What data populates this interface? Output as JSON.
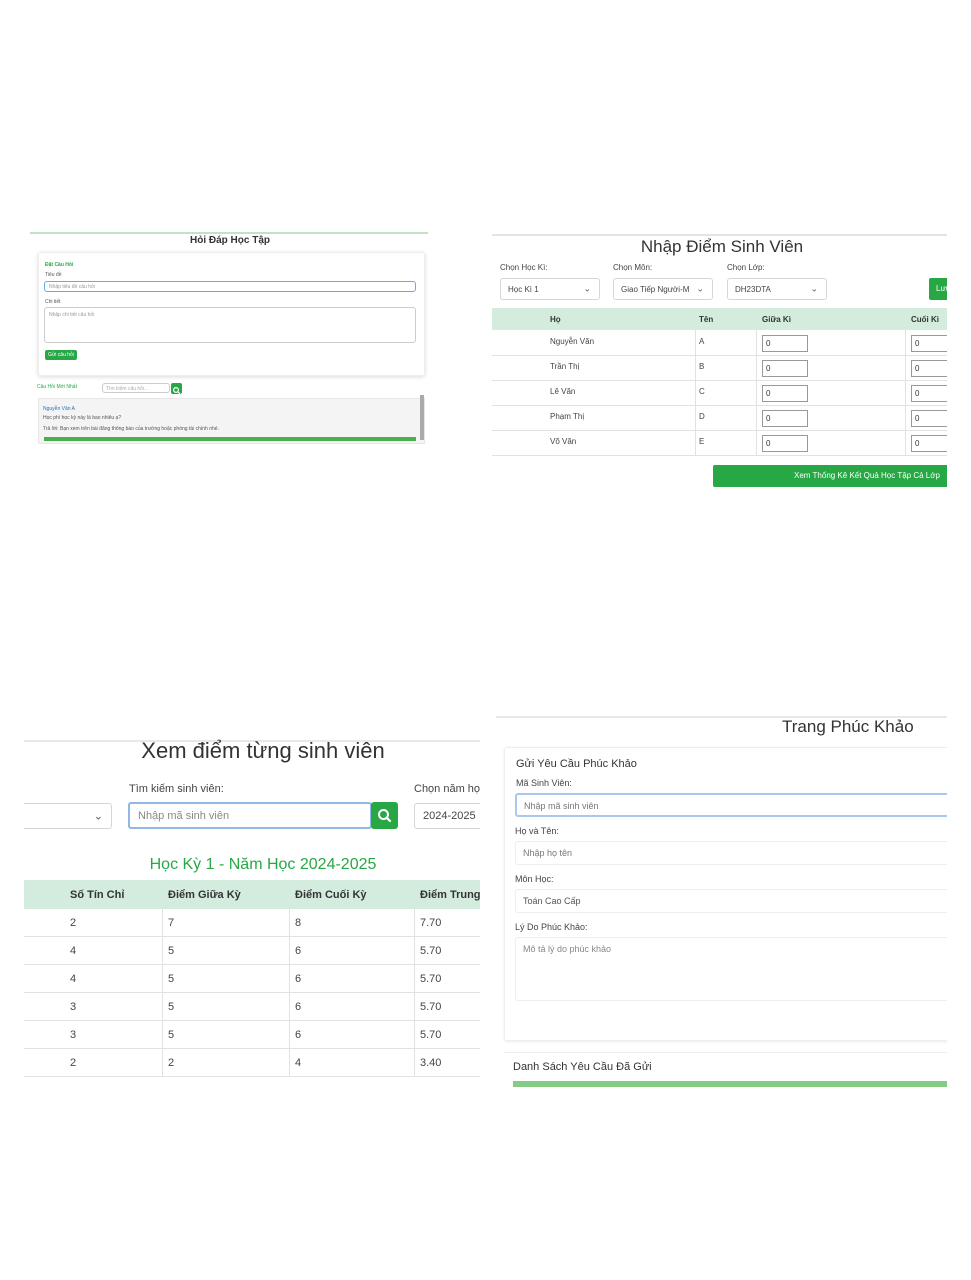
{
  "qa": {
    "title": "Hỏi Đáp Học Tập",
    "form_heading": "Đặt Câu Hỏi",
    "title_label": "Tiêu đề",
    "title_placeholder": "Nhập tiêu đề câu hỏi",
    "content_label": "Chi tiết",
    "content_placeholder": "Nhập chi tiết câu hỏi",
    "submit_label": "Gửi câu hỏi",
    "latest_label": "Câu Hỏi Mới Nhất",
    "search_placeholder": "Tìm kiếm câu hỏi...",
    "item_author": "Nguyễn Văn A",
    "item_question": "Học phí học kỳ này là bao nhiêu ạ?",
    "item_answer": "Trả lời: Bạn xem trên bài đăng thông báo của trường hoặc phòng tài chính nhé."
  },
  "grades_entry": {
    "title": "Nhập Điểm Sinh Viên",
    "semester_label": "Chọn Học Kì:",
    "semester_value": "Học Kì 1",
    "subject_label": "Chọn Môn:",
    "subject_value": "Giao Tiếp Người-M",
    "class_label": "Chọn Lớp:",
    "class_value": "DH23DTA",
    "save_label": "Lưu",
    "columns": [
      "Họ",
      "Tên",
      "Giữa Kì",
      "Cuối Kì"
    ],
    "rows": [
      {
        "ho": "Nguyễn Văn",
        "ten": "A",
        "giua": "0",
        "cuoi": "0"
      },
      {
        "ho": "Trần Thị",
        "ten": "B",
        "giua": "0",
        "cuoi": "0"
      },
      {
        "ho": "Lê Văn",
        "ten": "C",
        "giua": "0",
        "cuoi": "0"
      },
      {
        "ho": "Phạm Thị",
        "ten": "D",
        "giua": "0",
        "cuoi": "0"
      },
      {
        "ho": "Võ Văn",
        "ten": "E",
        "giua": "0",
        "cuoi": "0"
      }
    ],
    "stats_button": "Xem Thống Kê Kết Quả Học Tập Cả Lớp"
  },
  "student_view": {
    "title": "Xem điểm từng sinh viên",
    "search_label": "Tìm kiếm sinh viên:",
    "search_placeholder": "Nhập mã sinh viên",
    "year_label": "Chọn năm họ",
    "year_value": "2024-2025",
    "semester_heading": "Học Kỳ 1 - Năm Học 2024-2025",
    "columns": [
      "Số Tín Chỉ",
      "Điểm Giữa Kỳ",
      "Điểm Cuối Kỳ",
      "Điểm Trung"
    ],
    "rows": [
      [
        "2",
        "7",
        "8",
        "7.70"
      ],
      [
        "4",
        "5",
        "6",
        "5.70"
      ],
      [
        "4",
        "5",
        "6",
        "5.70"
      ],
      [
        "3",
        "5",
        "6",
        "5.70"
      ],
      [
        "3",
        "5",
        "6",
        "5.70"
      ],
      [
        "2",
        "2",
        "4",
        "3.40"
      ]
    ]
  },
  "appeal": {
    "title": "Trang Phúc Khảo",
    "form_heading": "Gửi Yêu Cầu Phúc Khảo",
    "student_id_label": "Mã Sinh Viên:",
    "student_id_placeholder": "Nhập mã sinh viên",
    "name_label": "Họ và Tên:",
    "name_placeholder": "Nhập họ tên",
    "subject_label": "Môn Học:",
    "subject_value": "Toán Cao Cấp",
    "reason_label": "Lý Do Phúc Khảo:",
    "reason_placeholder": "Mô tả lý do phúc khảo",
    "list_heading": "Danh Sách Yêu Cầu Đã Gửi"
  },
  "colors": {
    "accent": "#28a745",
    "table_header": "#d3ecdd"
  }
}
